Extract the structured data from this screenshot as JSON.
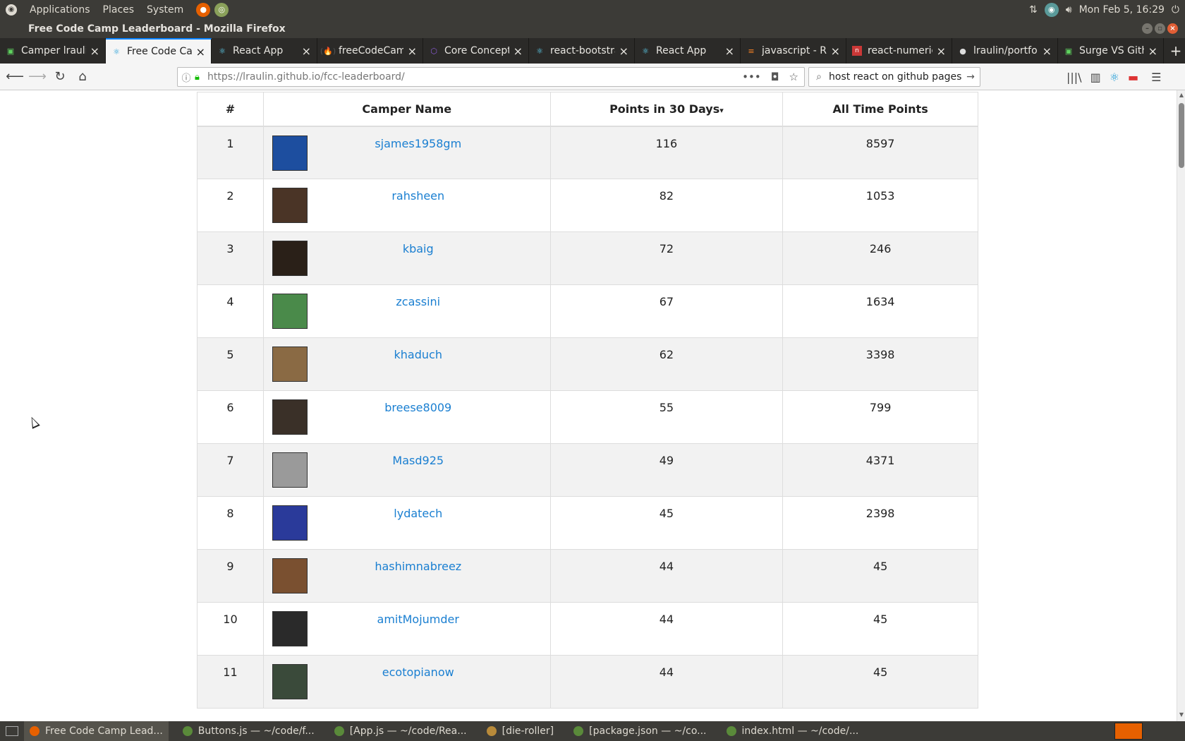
{
  "top_panel": {
    "menus": [
      "Applications",
      "Places",
      "System"
    ],
    "clock": "Mon Feb  5, 16:29"
  },
  "window": {
    "title": "Free Code Camp Leaderboard - Mozilla Firefox"
  },
  "tabs": [
    {
      "label": "Camper lraulin",
      "icon": "surge-icon",
      "active": false
    },
    {
      "label": "Free Code Camp",
      "icon": "react-icon",
      "active": true
    },
    {
      "label": "React App",
      "icon": "react-icon",
      "active": false
    },
    {
      "label": "freeCodeCamp",
      "icon": "freecodecamp-icon",
      "active": false
    },
    {
      "label": "Core Concepts",
      "icon": "core-icon",
      "active": false
    },
    {
      "label": "react-bootstrap",
      "icon": "react-icon",
      "active": false
    },
    {
      "label": "React App",
      "icon": "react-icon",
      "active": false
    },
    {
      "label": "javascript - R",
      "icon": "stackoverflow-icon",
      "active": false
    },
    {
      "label": "react-numeric",
      "icon": "npm-icon",
      "active": false
    },
    {
      "label": "lraulin/portfo",
      "icon": "github-icon",
      "active": false
    },
    {
      "label": "Surge VS Gith",
      "icon": "surge-icon",
      "active": false
    }
  ],
  "nav": {
    "url_host": "https://lraulin.github.io",
    "url_path": "/fcc-leaderboard/",
    "search_value": "host react on github pages"
  },
  "table": {
    "headers": [
      "#",
      "Camper Name",
      "Points in 30 Days",
      "All Time Points"
    ],
    "sort_caret": "▾",
    "rows": [
      {
        "rank": "1",
        "name": "sjames1958gm",
        "recent": "116",
        "alltime": "8597",
        "avatar_color": "#1d4e9f"
      },
      {
        "rank": "2",
        "name": "rahsheen",
        "recent": "82",
        "alltime": "1053",
        "avatar_color": "#4a3426"
      },
      {
        "rank": "3",
        "name": "kbaig",
        "recent": "72",
        "alltime": "246",
        "avatar_color": "#2a2018"
      },
      {
        "rank": "4",
        "name": "zcassini",
        "recent": "67",
        "alltime": "1634",
        "avatar_color": "#4a8a4a"
      },
      {
        "rank": "5",
        "name": "khaduch",
        "recent": "62",
        "alltime": "3398",
        "avatar_color": "#8a6a44"
      },
      {
        "rank": "6",
        "name": "breese8009",
        "recent": "55",
        "alltime": "799",
        "avatar_color": "#3a3028"
      },
      {
        "rank": "7",
        "name": "Masd925",
        "recent": "49",
        "alltime": "4371",
        "avatar_color": "#9a9a9a"
      },
      {
        "rank": "8",
        "name": "lydatech",
        "recent": "45",
        "alltime": "2398",
        "avatar_color": "#2a3a9a"
      },
      {
        "rank": "9",
        "name": "hashimnabreez",
        "recent": "44",
        "alltime": "45",
        "avatar_color": "#7a5030"
      },
      {
        "rank": "10",
        "name": "amitMojumder",
        "recent": "44",
        "alltime": "45",
        "avatar_color": "#2a2a2a"
      },
      {
        "rank": "11",
        "name": "ecotopianow",
        "recent": "44",
        "alltime": "45",
        "avatar_color": "#3a4a3a"
      }
    ]
  },
  "taskbar": [
    {
      "label": "Free Code Camp Lead...",
      "active": true,
      "color": "#e66000"
    },
    {
      "label": "Buttons.js — ~/code/f...",
      "active": false,
      "color": "#5a8a3a"
    },
    {
      "label": "[App.js — ~/code/Rea...",
      "active": false,
      "color": "#5a8a3a"
    },
    {
      "label": "[die-roller]",
      "active": false,
      "color": "#b88a3a"
    },
    {
      "label": "[package.json — ~/co...",
      "active": false,
      "color": "#5a8a3a"
    },
    {
      "label": "index.html — ~/code/...",
      "active": false,
      "color": "#5a8a3a"
    }
  ]
}
